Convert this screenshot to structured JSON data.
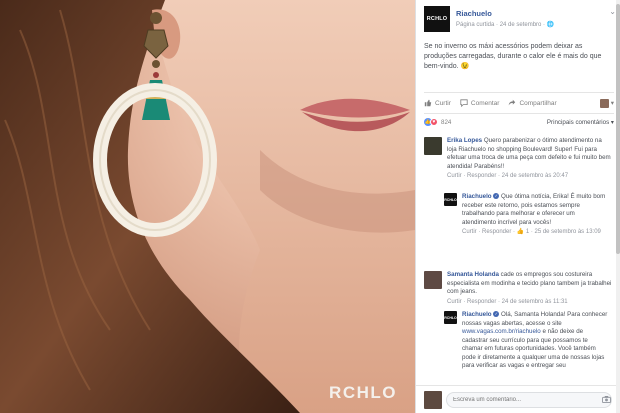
{
  "photo": {
    "watermark": "RCHLO"
  },
  "post": {
    "page_logo": "RCHLO",
    "page_name": "Riachuelo",
    "page_meta": "Página curtida · 24 de setembro · 🌐",
    "caret": "⌄",
    "text": "Se no inverno os máxi acessórios podem deixar as produções carregadas, durante o calor ele é mais do que bem-vindo. 😉"
  },
  "actions": {
    "like": "Curtir",
    "comment": "Comentar",
    "share": "Compartilhar",
    "avatar_caret": "▾"
  },
  "reactions": {
    "count": "824",
    "sort": "Principais comentários ▾"
  },
  "comments": [
    {
      "author": "Erika Lopes",
      "text": "Quero parabenizar o ótimo atendimento na loja Riachuelo no shopping Boulevard! Super! Fui para efetuar uma troca de uma peça com defeito e fui muito bem atendida! Parabéns!!",
      "meta": "Curtir · Responder · 24 de setembro às 20:47",
      "reply": {
        "author": "Riachuelo",
        "text": "Que ótima notícia, Erika! É muito bom receber este retorno, pois estamos sempre trabalhando para melhorar e oferecer um atendimento incrível para vocês!",
        "meta": "Curtir · Responder · 👍 1 · 25 de setembro às 13:09"
      }
    },
    {
      "author": "Samanta Holanda",
      "text": "cade os empregos sou costureira especialista em modinha e tecido plano tambem ja trabalhei com jeans.",
      "meta": "Curtir · Responder · 24 de setembro às 11:31",
      "reply": {
        "author": "Riachuelo",
        "text_1": "Olá, Samanta Holanda! Para conhecer nossas vagas abertas, acesse o site",
        "link": "www.vagas.com.br/riachuelo",
        "text_2": "e não deixe de cadastrar seu currículo para que possamos te chamar em futuras oportunidades. Você também pode ir diretamente a qualquer uma de nossas lojas para verificar as vagas e entregar seu"
      }
    }
  ],
  "composer": {
    "placeholder": "Escreva um comentário..."
  },
  "colors": {
    "link": "#365899",
    "meta": "#90949c",
    "like": "#5890ff",
    "love": "#f25268"
  }
}
